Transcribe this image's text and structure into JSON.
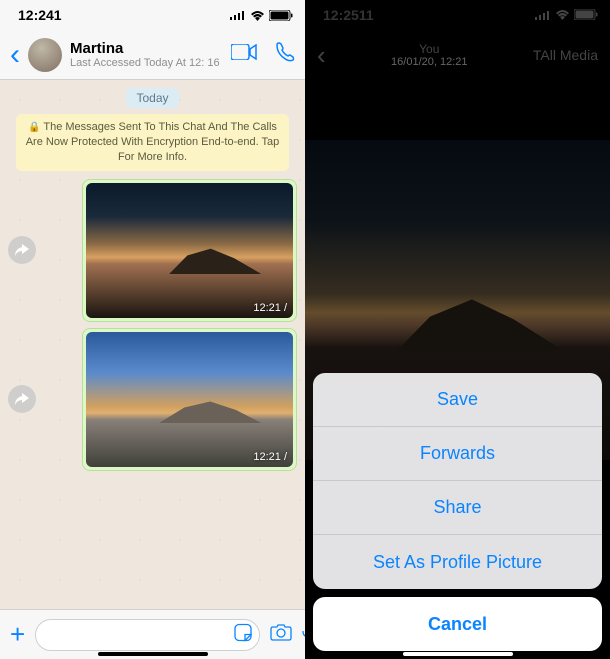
{
  "left": {
    "statusbar": {
      "time": "12:241"
    },
    "header": {
      "contact_name": "Martina",
      "subtitle": "Last Accessed Today At 12: 16"
    },
    "chat": {
      "date_pill": "Today",
      "encryption_notice": "The Messages Sent To This Chat And The Calls Are Now Protected With Encryption End-to-end. Tap For More Info.",
      "messages": [
        {
          "time": "12:21 /"
        },
        {
          "time": "12:21 /"
        }
      ]
    },
    "input": {
      "placeholder": ""
    }
  },
  "right": {
    "statusbar": {
      "time": "12:2511"
    },
    "header": {
      "title": "You",
      "subtitle": "16/01/20, 12:21",
      "all_media": "TAll Media"
    },
    "sheet": {
      "items": [
        "Save",
        "Forwards",
        "Share",
        "Set As Profile Picture"
      ],
      "cancel": "Cancel"
    }
  }
}
